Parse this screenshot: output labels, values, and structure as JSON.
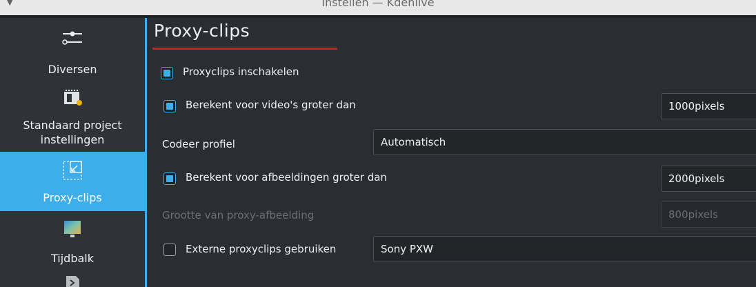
{
  "window": {
    "title": "Instellen — Kdenlive"
  },
  "sidebar": {
    "items": [
      {
        "label": "Diversen",
        "icon": "sliders-icon"
      },
      {
        "label": "Standaard project instellingen",
        "line1": "Standaard project",
        "line2": "instellingen",
        "icon": "film-project-icon"
      },
      {
        "label": "Proxy-clips",
        "icon": "proxy-resize-icon",
        "active": true
      },
      {
        "label": "Tijdbalk",
        "icon": "monitor-icon"
      },
      {
        "label": "",
        "icon": "capture-icon"
      }
    ]
  },
  "main": {
    "title": "Proxy-clips",
    "enable_proxy": {
      "label": "Proxyclips inschakelen",
      "checked": true
    },
    "video_larger": {
      "label": "Berekent voor video's groter dan",
      "checked": true,
      "value": "1000pixels"
    },
    "encoding_profile": {
      "label": "Codeer profiel",
      "value": "Automatisch"
    },
    "images_larger": {
      "label": "Berekent voor afbeeldingen groter dan",
      "checked": true,
      "value": "2000pixels"
    },
    "proxy_image_size": {
      "label": "Grootte van proxy-afbeelding",
      "value": "800pixels",
      "disabled": true
    },
    "external_proxy": {
      "label": "Externe proxyclips gebruiken",
      "checked": false,
      "value": "Sony PXW"
    }
  },
  "colors": {
    "accent": "#3daee9",
    "underline": "#da1e1e",
    "background": "#2a2e32",
    "sidebar": "#2f3337"
  }
}
